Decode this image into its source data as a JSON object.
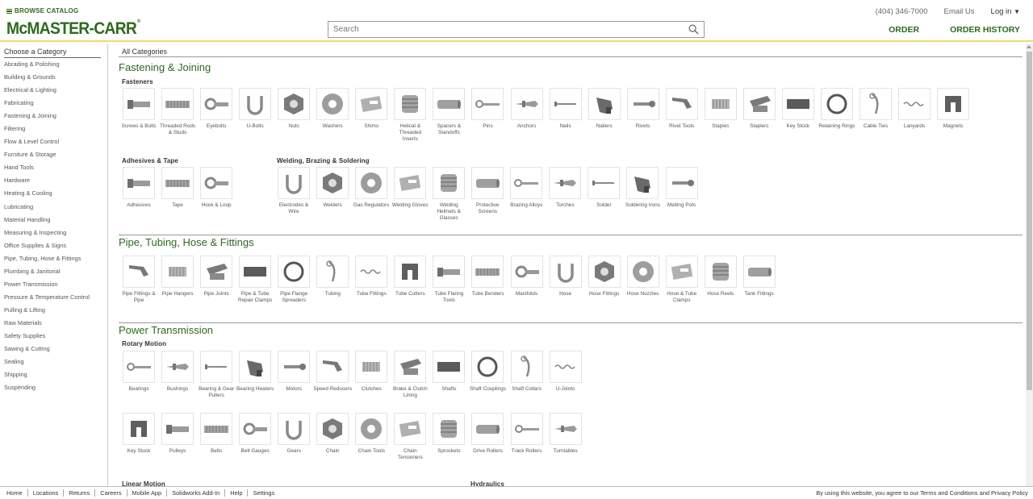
{
  "header": {
    "browse_label": "BROWSE CATALOG",
    "logo_text": "McMASTER-CARR",
    "logo_reg": "®",
    "search_placeholder": "Search",
    "phone": "(404) 346-7000",
    "email_label": "Email Us",
    "login_label": "Log in",
    "order_label": "ORDER",
    "order_history_label": "ORDER HISTORY"
  },
  "sidebar": {
    "title": "Choose a Category",
    "items": [
      "Abrading & Polishing",
      "Building & Grounds",
      "Electrical & Lighting",
      "Fabricating",
      "Fastening & Joining",
      "Filtering",
      "Flow & Level Control",
      "Furniture & Storage",
      "Hand Tools",
      "Hardware",
      "Heating & Cooling",
      "Lubricating",
      "Material Handling",
      "Measuring & Inspecting",
      "Office Supplies & Signs",
      "Pipe, Tubing, Hose & Fittings",
      "Plumbing & Janitorial",
      "Power Transmission",
      "Pressure & Temperature Control",
      "Pulling & Lifting",
      "Raw Materials",
      "Safety Supplies",
      "Sawing & Cutting",
      "Sealing",
      "Shipping",
      "Suspending"
    ]
  },
  "main": {
    "all_categories": "All Categories",
    "sections": [
      {
        "title": "Fastening & Joining"
      },
      {
        "title": "Pipe, Tubing, Hose & Fittings"
      },
      {
        "title": "Power Transmission"
      }
    ],
    "groups": [
      {
        "title": "Fasteners",
        "items": [
          "Screws & Bolts",
          "Threaded Rods & Studs",
          "Eyebolts",
          "U-Bolts",
          "Nuts",
          "Washers",
          "Shims",
          "Helical & Threaded Inserts",
          "Spacers & Standoffs",
          "Pins",
          "Anchors",
          "Nails",
          "Nailers",
          "Rivets",
          "Rivet Tools",
          "Staples",
          "Staplers",
          "Key Stock",
          "Retaining Rings",
          "Cable Ties",
          "Lanyards",
          "Magnets"
        ]
      },
      {
        "title": "Adhesives & Tape",
        "items": [
          "Adhesives",
          "Tape",
          "Hook & Loop"
        ]
      },
      {
        "title": "Welding, Brazing & Soldering",
        "items": [
          "Electrodes & Wire",
          "Welders",
          "Gas Regulators",
          "Welding Gloves",
          "Welding Helmets & Glasses",
          "Protective Screens",
          "Brazing Alloys",
          "Torches",
          "Solder",
          "Soldering Irons",
          "Melting Pots"
        ]
      },
      {
        "title": "",
        "items": [
          "Pipe Fittings & Pipe",
          "Pipe Hangers",
          "Pipe Joints",
          "Pipe & Tube Repair Clamps",
          "Pipe Flange Spreaders",
          "Tubing",
          "Tube Fittings",
          "Tube Cutters",
          "Tube Flaring Tools",
          "Tube Benders",
          "Manifolds",
          "Hose",
          "Hose Fittings",
          "Hose Nozzles",
          "Hose & Tube Clamps",
          "Hose Reels",
          "Tank Fittings"
        ]
      },
      {
        "title": "Rotary Motion",
        "items": [
          "Bearings",
          "Bushings",
          "Bearing & Gear Pullers",
          "Bearing Heaters",
          "Motors",
          "Speed Reducers",
          "Clutches",
          "Brake & Clutch Lining",
          "Shafts",
          "Shaft Couplings",
          "Shaft Collars",
          "U-Joints"
        ]
      },
      {
        "title": "",
        "items": [
          "Key Stock",
          "Pulleys",
          "Belts",
          "Belt Gauges",
          "Gears",
          "Chain",
          "Chain Tools",
          "Chain Tensioners",
          "Sprockets",
          "Drive Rollers",
          "Track Rollers",
          "Turntables"
        ]
      },
      {
        "title": "Linear Motion",
        "items": []
      },
      {
        "title": "Hydraulics",
        "items": []
      }
    ]
  },
  "footer": {
    "links": [
      "Home",
      "Locations",
      "Returns",
      "Careers",
      "Mobile App",
      "Solidworks Add-In",
      "Help",
      "Settings"
    ],
    "legal": "By using this website, you agree to our Terms and Conditions and Privacy Policy"
  },
  "colors": {
    "brand_green": "#2d6a1f",
    "header_rule": "#f2d86a"
  }
}
